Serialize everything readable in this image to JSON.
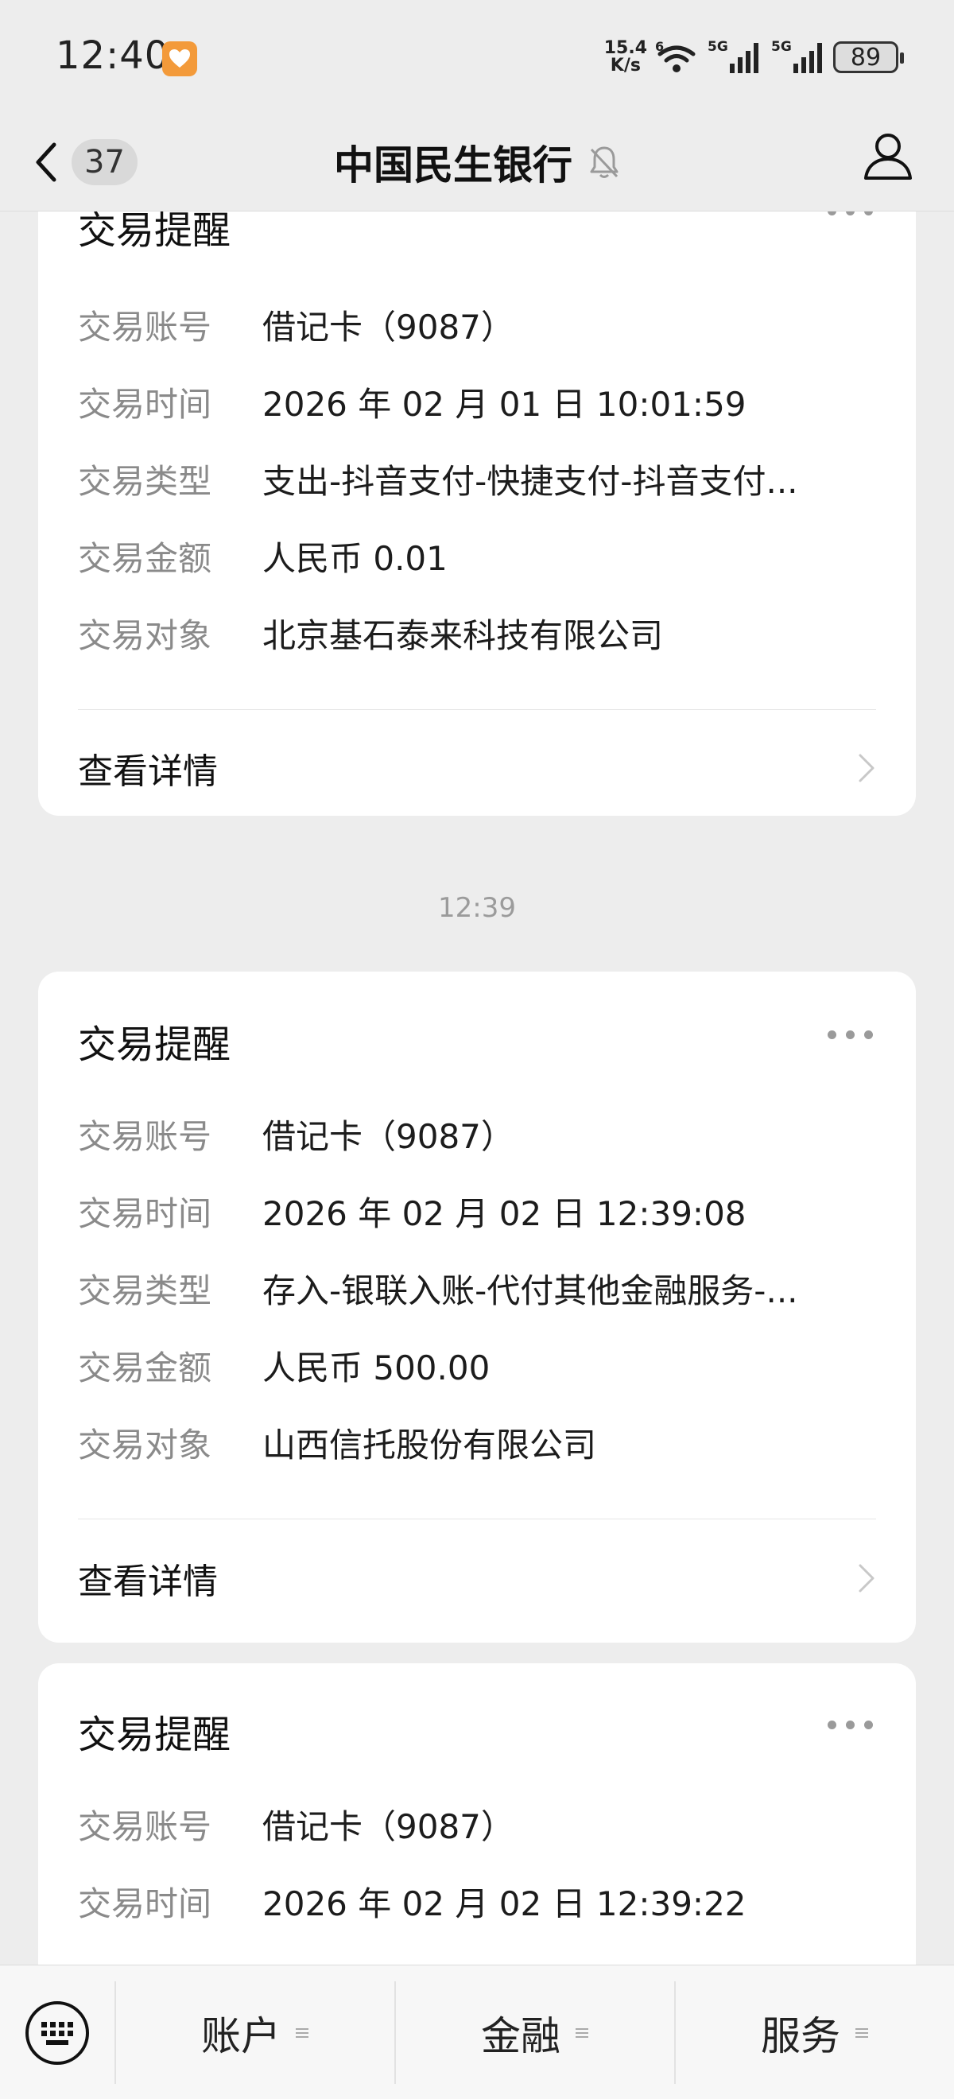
{
  "status_bar": {
    "time": "12:40",
    "net_speed_value": "15.4",
    "net_speed_unit": "K/s",
    "signal_1": "5G",
    "signal_2": "5G",
    "wifi_tag": "6",
    "battery": "89"
  },
  "header": {
    "back_count": "37",
    "title": "中国民生银行"
  },
  "messages": [
    {
      "title": "交易提醒",
      "rows": [
        {
          "label": "交易账号",
          "value": "借记卡（9087）"
        },
        {
          "label": "交易时间",
          "value": "2026 年 02 月 01 日 10:01:59"
        },
        {
          "label": "交易类型",
          "value": "支出-抖音支付-快捷支付-抖音支付..."
        },
        {
          "label": "交易金额",
          "value": "人民币 0.01"
        },
        {
          "label": "交易对象",
          "value": "北京基石泰来科技有限公司"
        }
      ],
      "detail_link": "查看详情"
    },
    {
      "timestamp": "12:39",
      "title": "交易提醒",
      "rows": [
        {
          "label": "交易账号",
          "value": "借记卡（9087）"
        },
        {
          "label": "交易时间",
          "value": "2026 年 02 月 02 日 12:39:08"
        },
        {
          "label": "交易类型",
          "value": "存入-银联入账-代付其他金融服务-..."
        },
        {
          "label": "交易金额",
          "value": "人民币 500.00"
        },
        {
          "label": "交易对象",
          "value": "山西信托股份有限公司"
        }
      ],
      "detail_link": "查看详情"
    },
    {
      "title": "交易提醒",
      "rows": [
        {
          "label": "交易账号",
          "value": "借记卡（9087）"
        },
        {
          "label": "交易时间",
          "value": "2026 年 02 月 02 日 12:39:22"
        }
      ]
    }
  ],
  "bottom_menu": [
    {
      "label": "账户"
    },
    {
      "label": "金融"
    },
    {
      "label": "服务"
    }
  ]
}
